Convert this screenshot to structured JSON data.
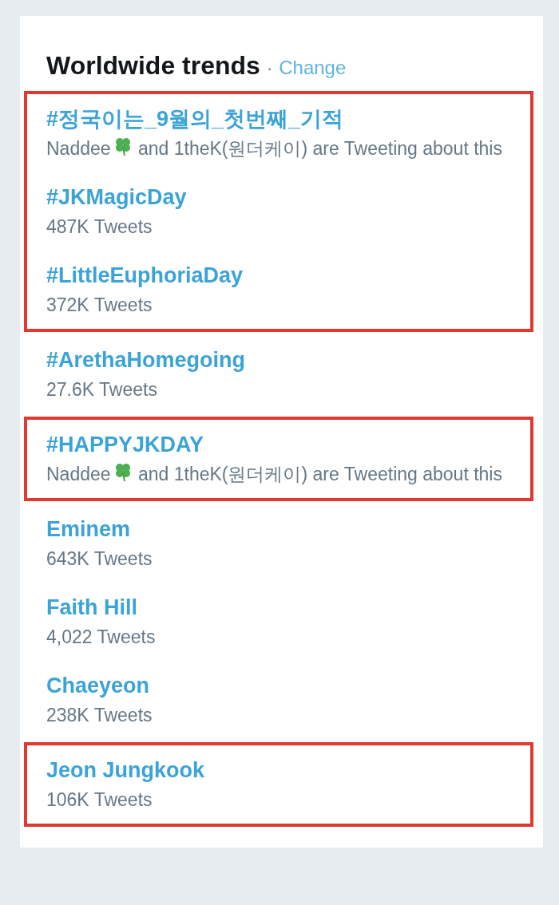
{
  "panel": {
    "title": "Worldwide trends",
    "separator": "·",
    "change_link": "Change"
  },
  "groups": [
    {
      "highlighted": true,
      "trends": [
        {
          "name": "#정국이는_9월의_첫번째_기적",
          "context_parts": [
            "Naddee",
            "and 1theK(원더케이) are Tweeting about this"
          ]
        },
        {
          "name": "#JKMagicDay",
          "count": "487K Tweets"
        },
        {
          "name": "#LittleEuphoriaDay",
          "count": "372K Tweets"
        }
      ]
    },
    {
      "highlighted": false,
      "trends": [
        {
          "name": "#ArethaHomegoing",
          "count": "27.6K Tweets"
        }
      ]
    },
    {
      "highlighted": true,
      "trends": [
        {
          "name": "#HAPPYJKDAY",
          "context_parts": [
            "Naddee",
            "and 1theK(원더케이) are Tweeting about this"
          ]
        }
      ]
    },
    {
      "highlighted": false,
      "trends": [
        {
          "name": "Eminem",
          "count": "643K Tweets"
        },
        {
          "name": "Faith Hill",
          "count": "4,022 Tweets"
        },
        {
          "name": "Chaeyeon",
          "count": "238K Tweets"
        }
      ]
    },
    {
      "highlighted": true,
      "trends": [
        {
          "name": "Jeon Jungkook",
          "count": "106K Tweets"
        }
      ]
    }
  ]
}
